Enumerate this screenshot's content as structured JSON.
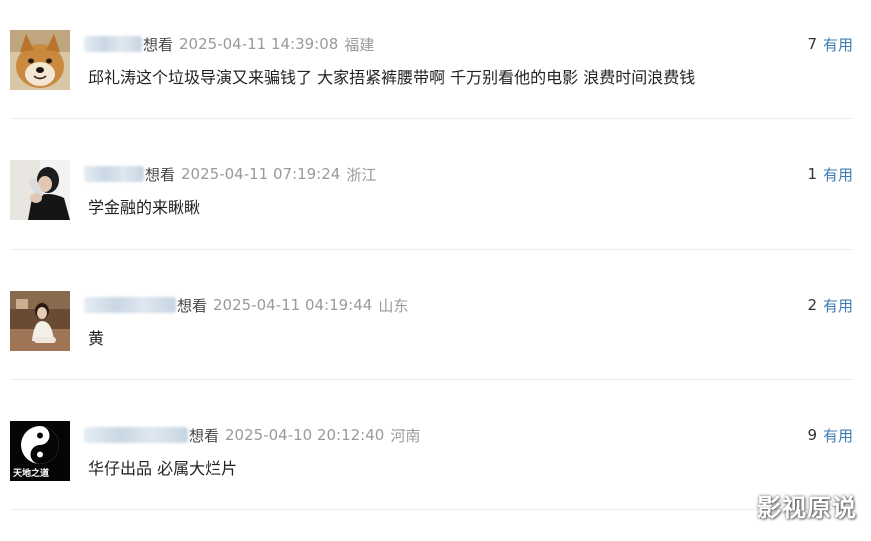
{
  "comments": [
    {
      "status": "想看",
      "time": "2025-04-11 14:39:08",
      "location": "福建",
      "votes": "7",
      "useful_label": "有用",
      "content": "邱礼涛这个垃圾导演又来骗钱了 大家捂紧裤腰带啊 千万别看他的电影 浪费时间浪费钱",
      "avatar_icon": "shiba-dog-avatar"
    },
    {
      "status": "想看",
      "time": "2025-04-11 07:19:24",
      "location": "浙江",
      "votes": "1",
      "useful_label": "有用",
      "content": "学金融的来瞅瞅",
      "avatar_icon": "person-with-bottle-avatar"
    },
    {
      "status": "想看",
      "time": "2025-04-11 04:19:44",
      "location": "山东",
      "votes": "2",
      "useful_label": "有用",
      "content": "黄",
      "avatar_icon": "woman-sitting-avatar"
    },
    {
      "status": "想看",
      "time": "2025-04-10 20:12:40",
      "location": "河南",
      "votes": "9",
      "useful_label": "有用",
      "content": "华仔出品 必属大烂片",
      "avatar_icon": "yin-yang-avatar",
      "avatar_text": "天地之道"
    }
  ],
  "watermark": "影视原说",
  "colors": {
    "useful_link": "#3d7cb3",
    "meta_gray": "#9a9a9a",
    "divider": "#ececec"
  }
}
